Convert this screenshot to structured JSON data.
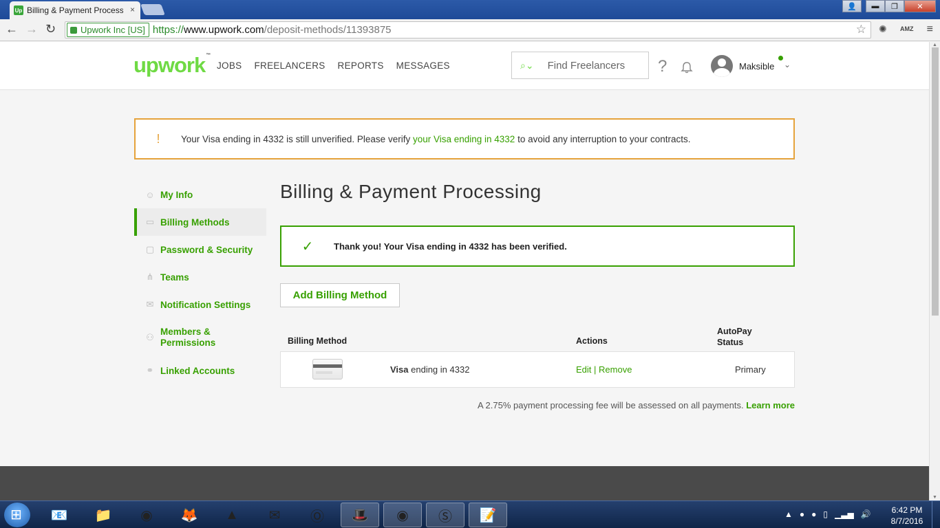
{
  "browser": {
    "tab_title": "Billing & Payment Processing",
    "tab_close": "×",
    "ev_badge": "Upwork Inc [US]",
    "url_scheme": "https://",
    "url_host": "www.upwork.com",
    "url_path": "/deposit-methods/11393875",
    "window_buttons": {
      "minimize": "▬",
      "maximize": "❐",
      "close": "✕"
    },
    "ext_amz": "AMZ"
  },
  "header": {
    "logo": "upwork",
    "logo_tm": "™",
    "nav": [
      "JOBS",
      "FREELANCERS",
      "REPORTS",
      "MESSAGES"
    ],
    "search_placeholder": "Find Freelancers",
    "help": "?",
    "username": "Maksible",
    "status_color": "#37a000"
  },
  "alert": {
    "text_before": "Your Visa ending in 4332 is still unverified. Please verify ",
    "link_text": "your Visa ending in 4332",
    "text_after": " to avoid any interruption to your contracts.",
    "icon": "!"
  },
  "sidebar": {
    "items": [
      {
        "label": "My Info",
        "icon": "user-icon"
      },
      {
        "label": "Billing Methods",
        "icon": "credit-card-icon",
        "active": true
      },
      {
        "label": "Password & Security",
        "icon": "lock-icon"
      },
      {
        "label": "Teams",
        "icon": "teams-icon"
      },
      {
        "label": "Notification Settings",
        "icon": "envelope-icon"
      },
      {
        "label": "Members & Permissions",
        "icon": "members-icon"
      },
      {
        "label": "Linked Accounts",
        "icon": "link-icon"
      }
    ]
  },
  "main": {
    "title": "Billing & Payment Processing",
    "success_text": "Thank you! Your Visa ending in 4332 has been verified.",
    "add_button": "Add Billing Method",
    "table": {
      "headers": [
        "Billing Method",
        "Actions",
        "AutoPay Status"
      ],
      "rows": [
        {
          "brand": "Visa",
          "rest": " ending in 4332",
          "edit": "Edit",
          "sep": " | ",
          "remove": "Remove",
          "status": "Primary"
        }
      ]
    },
    "fee_text": "A 2.75% payment processing fee will be assessed on all payments. ",
    "fee_link": "Learn more"
  },
  "taskbar": {
    "time": "6:42 PM",
    "date": "8/7/2016"
  },
  "colors": {
    "brand_green": "#6fda44",
    "link_green": "#37a000",
    "warning_orange": "#e5a23a"
  }
}
